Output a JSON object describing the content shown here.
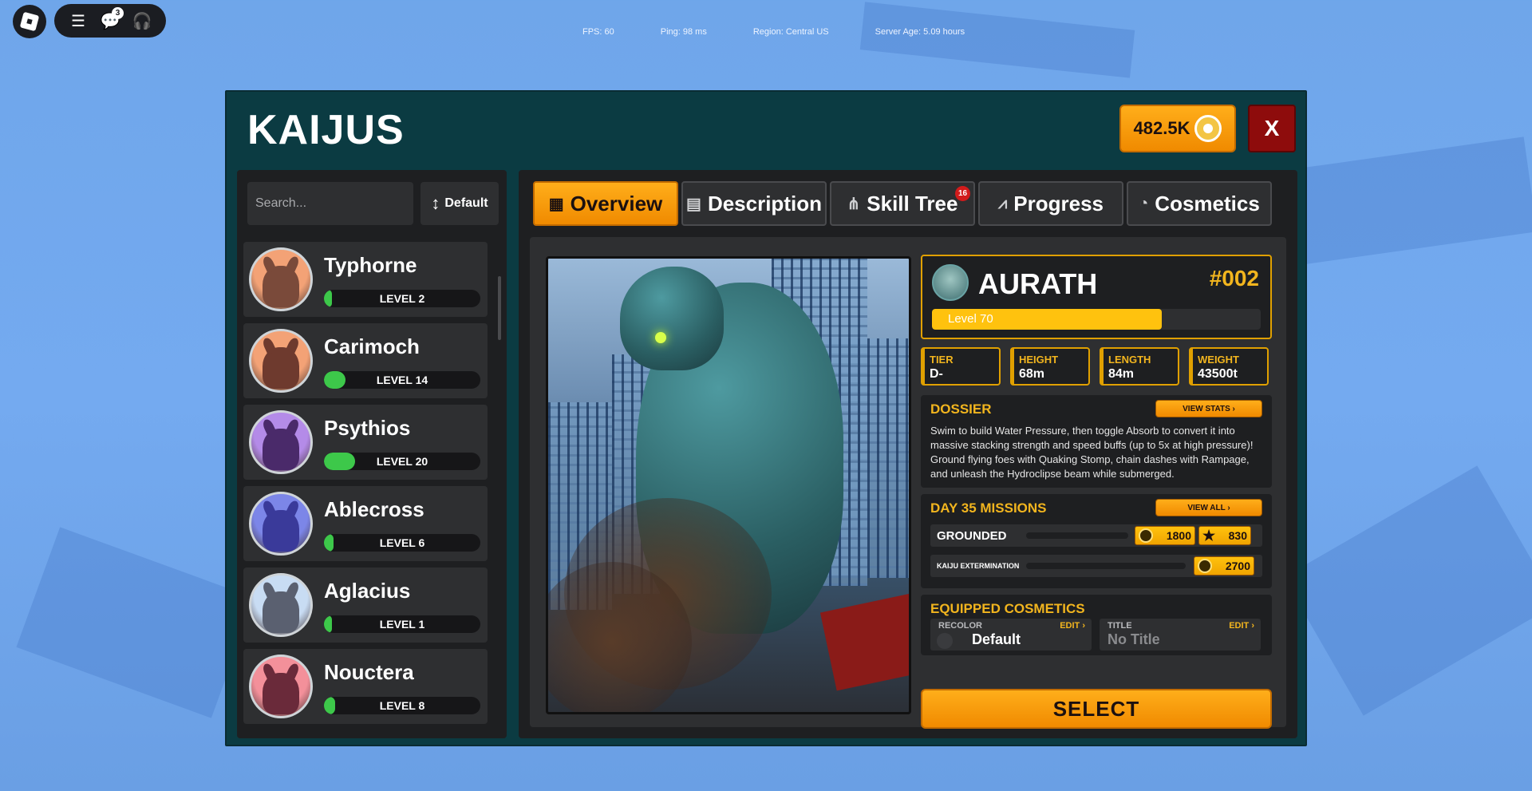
{
  "topbar": {
    "chat_badge": "3",
    "stats": [
      "FPS: 60",
      "Ping: 98 ms",
      "Region: Central US",
      "Server Age: 5.09 hours"
    ]
  },
  "panel": {
    "title": "KAIJUS",
    "coins": "482.5K",
    "close_label": "X"
  },
  "list": {
    "search_placeholder": "Search...",
    "sort_label": "Default",
    "items": [
      {
        "name": "Typhorne",
        "level": "LEVEL 2",
        "progress": 0.04,
        "ring": "#f3a276",
        "mon": "#7a4a3a"
      },
      {
        "name": "Carimoch",
        "level": "LEVEL 14",
        "progress": 0.14,
        "ring": "#f3a276",
        "mon": "#6e3a2e"
      },
      {
        "name": "Psythios",
        "level": "LEVEL 20",
        "progress": 0.2,
        "ring": "#b48be8",
        "mon": "#4a2a6a"
      },
      {
        "name": "Ablecross",
        "level": "LEVEL 6",
        "progress": 0.06,
        "ring": "#7c86e8",
        "mon": "#3a3a9a"
      },
      {
        "name": "Aglacius",
        "level": "LEVEL 1",
        "progress": 0.04,
        "ring": "#c8dcf3",
        "mon": "#5a6070"
      },
      {
        "name": "Nouctera",
        "level": "LEVEL 8",
        "progress": 0.07,
        "ring": "#f3909a",
        "mon": "#6a2a3a"
      }
    ]
  },
  "tabs": [
    {
      "label": "Overview",
      "icon": "grid-icon",
      "active": true
    },
    {
      "label": "Description",
      "icon": "document-icon",
      "active": false
    },
    {
      "label": "Skill Tree",
      "icon": "skill-tree-icon",
      "active": false,
      "badge": "16"
    },
    {
      "label": "Progress",
      "icon": "chart-icon",
      "active": false
    },
    {
      "label": "Cosmetics",
      "icon": "palette-icon",
      "active": false
    }
  ],
  "kaiju": {
    "name": "AURATH",
    "number": "#002",
    "level_label": "Level 70",
    "level_progress": 0.7,
    "stats": [
      {
        "label": "TIER",
        "value": "D-"
      },
      {
        "label": "HEIGHT",
        "value": "68m"
      },
      {
        "label": "LENGTH",
        "value": "84m"
      },
      {
        "label": "WEIGHT",
        "value": "43500t"
      }
    ]
  },
  "dossier": {
    "title": "DOSSIER",
    "button": "VIEW STATS ›",
    "text": "Swim to build Water Pressure, then toggle Absorb to convert it into massive stacking strength and speed buffs (up to 5x at high pressure)! Ground flying foes with Quaking Stomp, chain dashes with Rampage, and unleash the Hydroclipse beam while submerged."
  },
  "missions": {
    "title": "DAY 35 MISSIONS",
    "button": "VIEW ALL ›",
    "items": [
      {
        "name": "GROUNDED",
        "coins": "1800",
        "stars": "830"
      },
      {
        "name": "KAIJU EXTERMINATION",
        "coins": "2700"
      }
    ]
  },
  "cosmetics": {
    "title": "EQUIPPED COSMETICS",
    "recolor": {
      "label": "RECOLOR",
      "edit": "EDIT ›",
      "value": "Default"
    },
    "title_slot": {
      "label": "TITLE",
      "edit": "EDIT ›",
      "value": "No Title"
    }
  },
  "select_label": "SELECT",
  "colors": {
    "accent": "#f5a000",
    "panel": "#0b3b42",
    "gold_text": "#f2b51e",
    "progress_green": "#3dc84a"
  }
}
